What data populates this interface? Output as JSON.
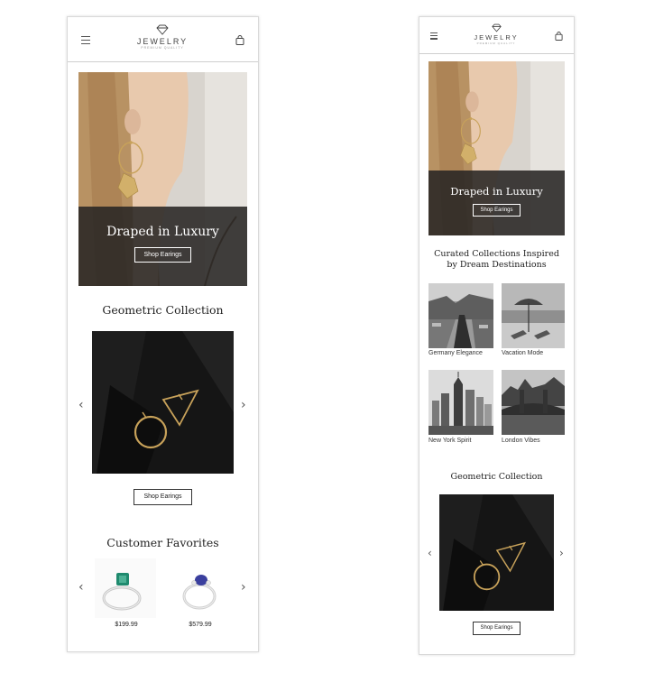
{
  "brand": {
    "name": "JEWELRY",
    "tagline": "PREMIUM QUALITY"
  },
  "hero": {
    "title": "Draped in Luxury",
    "button": "Shop Earings"
  },
  "curated": {
    "title_line1": "Curated Collections Inspired",
    "title_line2": "by Dream Destinations",
    "items": [
      {
        "label": "Germany Elegance"
      },
      {
        "label": "Vacation Mode"
      },
      {
        "label": "New York Spirit"
      },
      {
        "label": "London Vibes"
      }
    ]
  },
  "geometric": {
    "title": "Geometric Collection",
    "button": "Shop Earings",
    "prev": "‹",
    "next": "›"
  },
  "favorites": {
    "title": "Customer Favorites",
    "prev": "‹",
    "next": "›",
    "products": [
      {
        "price": "$199.99",
        "stone_color": "#1f8a6e"
      },
      {
        "price": "$579.99",
        "stone_color": "#3a3f9e"
      }
    ]
  },
  "icons": {
    "menu": "hamburger-icon",
    "logo": "diamond-icon",
    "cart": "shopping-bag-icon",
    "prev": "chevron-left-icon",
    "next": "chevron-right-icon"
  },
  "colors": {
    "hero_band": "#282624",
    "dark_product_bg": "#151515",
    "gold": "#c8a25a"
  }
}
